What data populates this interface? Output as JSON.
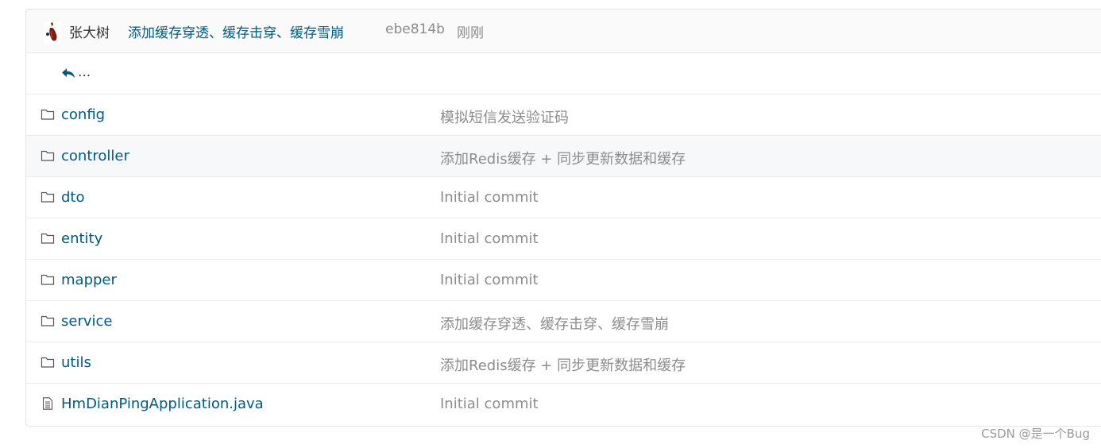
{
  "commit": {
    "author": "张大树",
    "message": "添加缓存穿透、缓存击穿、缓存雪崩",
    "sha": "ebe814b",
    "time": "刚刚"
  },
  "back": {
    "label": "..."
  },
  "files": [
    {
      "name": "config",
      "type": "folder",
      "message": "模拟短信发送验证码"
    },
    {
      "name": "controller",
      "type": "folder",
      "message": "添加Redis缓存 + 同步更新数据和缓存"
    },
    {
      "name": "dto",
      "type": "folder",
      "message": "Initial commit"
    },
    {
      "name": "entity",
      "type": "folder",
      "message": "Initial commit"
    },
    {
      "name": "mapper",
      "type": "folder",
      "message": "Initial commit"
    },
    {
      "name": "service",
      "type": "folder",
      "message": "添加缓存穿透、缓存击穿、缓存雪崩"
    },
    {
      "name": "utils",
      "type": "folder",
      "message": "添加Redis缓存 + 同步更新数据和缓存"
    },
    {
      "name": "HmDianPingApplication.java",
      "type": "file",
      "message": "Initial commit"
    }
  ],
  "watermark": "CSDN @是一个Bug",
  "colors": {
    "link": "#005980",
    "muted": "#8c8c8c",
    "highlight_row": "#f6f8fa"
  }
}
